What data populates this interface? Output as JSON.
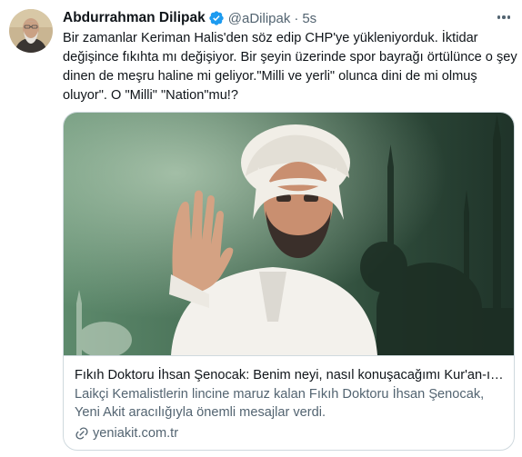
{
  "tweet": {
    "author": {
      "display_name": "Abdurrahman Dilipak",
      "handle": "@aDilipak",
      "verified": true
    },
    "separator": "·",
    "timestamp": "5s",
    "text": "Bir zamanlar Keriman Halis'den söz edip CHP'ye yükleniyorduk. İktidar değişince fıkıhta mı değişiyor. Bir şeyin üzerinde spor bayrağı örtülünce o şey dinen de meşru haline mi geliyor.\"Milli ve yerli\" olunca dini de mi olmuş oluyor\". O \"Milli\" \"Nation\"mu!?",
    "card": {
      "title": "Fıkıh Doktoru İhsan Şenocak: Benim neyi, nasıl konuşacağımı Kur'an-ı Kerim belirler",
      "description": "Laikçi Kemalistlerin lincine maruz kalan Fıkıh Doktoru İhsan Şenocak, Yeni Akit aracılığıyla önemli mesajlar verdi.",
      "domain": "yeniakit.com.tr"
    }
  },
  "icons": {
    "verified": "verified-badge-icon",
    "more": "more-horizontal-icon",
    "link": "link-icon"
  },
  "colors": {
    "text_primary": "#0f1419",
    "text_secondary": "#536471",
    "verified_blue": "#1d9bf0",
    "border": "#cfd9de"
  }
}
